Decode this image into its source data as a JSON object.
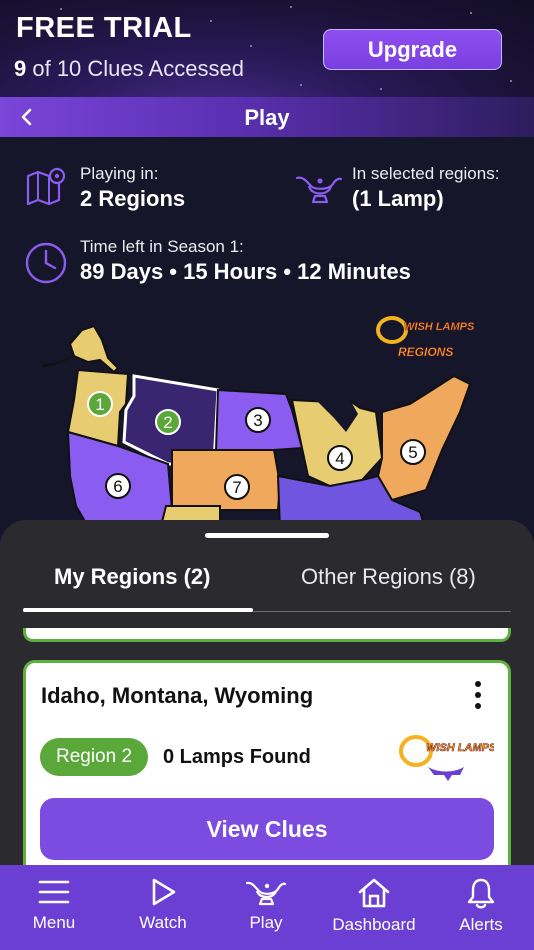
{
  "trial": {
    "title": "FREE TRIAL",
    "clues_count": "9",
    "clues_text": " of 10 Clues Accessed",
    "upgrade_label": "Upgrade"
  },
  "header": {
    "title": "Play",
    "back_icon": "chevron-left-icon"
  },
  "info": {
    "playing_label": "Playing in:",
    "playing_value": "2 Regions",
    "lamp_label": "In selected regions:",
    "lamp_value": "(1 Lamp)",
    "time_label": "Time left in Season 1:",
    "time_value": "89 Days • 15 Hours • 12 Minutes"
  },
  "map": {
    "logo_line1": "WISH LAMPS",
    "logo_line2": "REGIONS",
    "markers": [
      "1",
      "2",
      "3",
      "4",
      "5",
      "6",
      "7"
    ]
  },
  "tabs": {
    "mine": "My Regions (2)",
    "other": "Other Regions (8)"
  },
  "card": {
    "title": "Idaho, Montana, Wyoming",
    "badge": "Region 2",
    "lamps_found": "0 Lamps Found",
    "logo_text": "WISH LAMPS",
    "button": "View Clues"
  },
  "nav": [
    {
      "label": "Menu",
      "icon": "hamburger-icon"
    },
    {
      "label": "Watch",
      "icon": "play-icon"
    },
    {
      "label": "Play",
      "icon": "lamp-icon"
    },
    {
      "label": "Dashboard",
      "icon": "home-icon"
    },
    {
      "label": "Alerts",
      "icon": "bell-icon"
    }
  ],
  "colors": {
    "accent": "#7c4ce0",
    "region_active_border": "#5db13e",
    "badge_green": "#5aa83a",
    "background": "#16162a"
  }
}
